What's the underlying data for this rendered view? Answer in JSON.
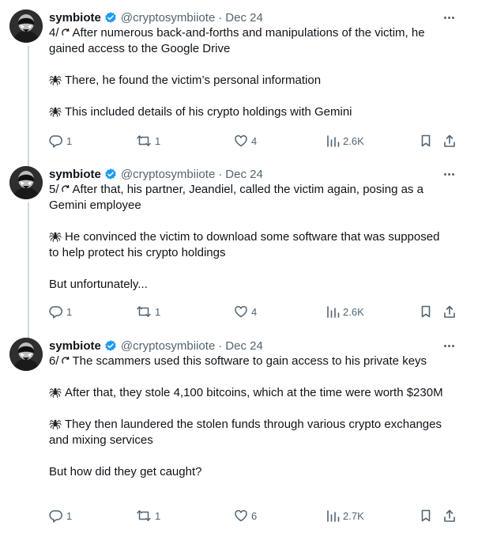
{
  "tweets": [
    {
      "name": "symbiote",
      "handle": "@cryptosymbiiote",
      "separator": "·",
      "date": "Dec 24",
      "thread_number": "4/",
      "paragraphs": [
        {
          "spider": false,
          "text": "After numerous back-and-forths and manipulations of the victim, he gained access to the Google Drive"
        },
        {
          "spider": true,
          "text": "There, he found the victim’s personal information"
        },
        {
          "spider": true,
          "text": "This included details of his crypto holdings with Gemini"
        }
      ],
      "replies": "1",
      "reposts": "1",
      "likes": "4",
      "views": "2.6K"
    },
    {
      "name": "symbiote",
      "handle": "@cryptosymbiiote",
      "separator": "·",
      "date": "Dec 24",
      "thread_number": "5/",
      "paragraphs": [
        {
          "spider": false,
          "text": "After that, his partner, Jeandiel, called the victim again, posing as a Gemini employee"
        },
        {
          "spider": true,
          "text": "He convinced the victim to download some software that was supposed to help protect his crypto holdings"
        },
        {
          "spider": false,
          "text": "But unfortunately..."
        }
      ],
      "replies": "1",
      "reposts": "1",
      "likes": "4",
      "views": "2.6K"
    },
    {
      "name": "symbiote",
      "handle": "@cryptosymbiiote",
      "separator": "·",
      "date": "Dec 24",
      "thread_number": "6/",
      "paragraphs": [
        {
          "spider": false,
          "text": "The scammers used this software to gain access to his private keys"
        },
        {
          "spider": true,
          "text": "After that, they stole 4,100 bitcoins, which at the time were worth $230M"
        },
        {
          "spider": true,
          "text": "They then laundered the stolen funds through various crypto exchanges and mixing services"
        },
        {
          "spider": false,
          "text": "But how did they get caught?"
        }
      ],
      "replies": "1",
      "reposts": "1",
      "likes": "6",
      "views": "2.7K"
    }
  ],
  "icons": {
    "verified": "verified-badge-icon",
    "thread": "thread-icon",
    "spider": "spider-icon",
    "more": "more-icon",
    "reply": "reply-icon",
    "repost": "repost-icon",
    "like": "like-icon",
    "views": "views-icon",
    "bookmark": "bookmark-icon",
    "share": "share-icon"
  },
  "colors": {
    "text": "#0f1419",
    "secondary": "#536471",
    "verified": "#1d9bf0",
    "thread_line": "#cfd9de"
  }
}
